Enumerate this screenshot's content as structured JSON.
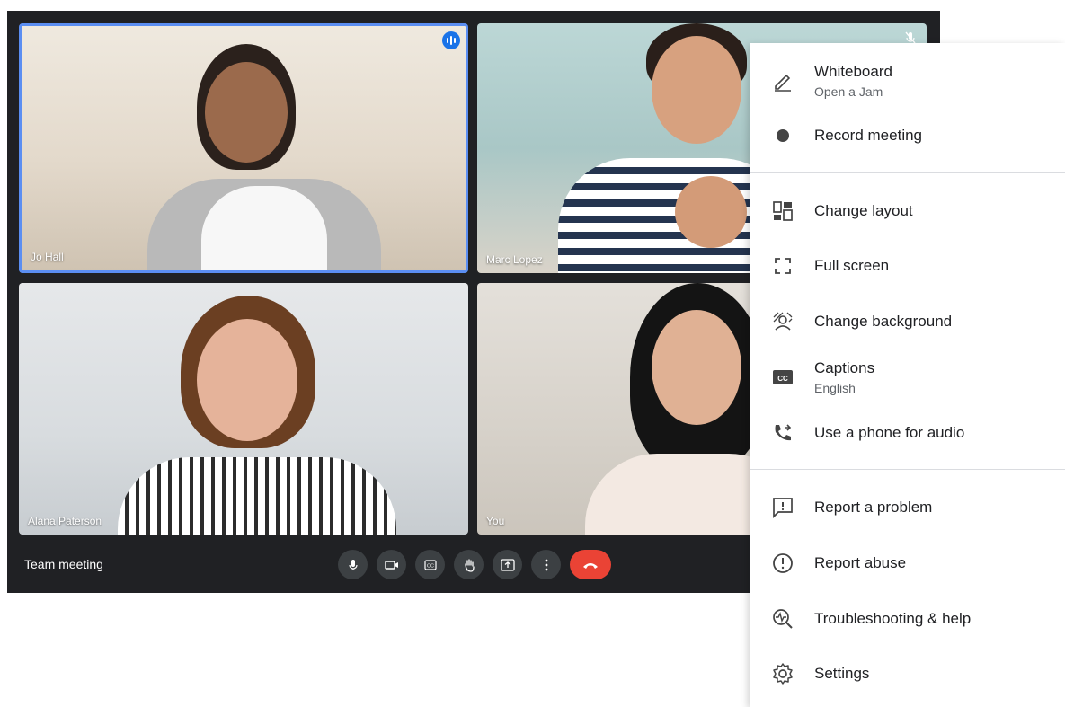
{
  "meeting": {
    "title": "Team meeting",
    "participants": [
      {
        "name": "Jo Hall",
        "speaking": true
      },
      {
        "name": "Marc Lopez",
        "muted": true
      },
      {
        "name": "Alana Paterson"
      },
      {
        "name": "You"
      }
    ],
    "controls": [
      {
        "name": "microphone",
        "icon": "mic-icon"
      },
      {
        "name": "camera",
        "icon": "camera-icon"
      },
      {
        "name": "captions",
        "icon": "captions-icon"
      },
      {
        "name": "raise-hand",
        "icon": "hand-icon"
      },
      {
        "name": "present",
        "icon": "present-icon"
      },
      {
        "name": "more-options",
        "icon": "more-vert-icon"
      },
      {
        "name": "leave-call",
        "icon": "end-call-icon"
      }
    ],
    "colors": {
      "background": "#202124",
      "control": "#3c4043",
      "end_call": "#ea4335",
      "speaking": "#1a73e8"
    }
  },
  "menu": {
    "items": [
      {
        "label": "Whiteboard",
        "sub": "Open a Jam",
        "icon": "pen-icon"
      },
      {
        "label": "Record meeting",
        "icon": "record-icon"
      },
      {
        "label": "Change layout",
        "icon": "layout-icon"
      },
      {
        "label": "Full screen",
        "icon": "fullscreen-icon"
      },
      {
        "label": "Change background",
        "icon": "background-icon"
      },
      {
        "label": "Captions",
        "sub": "English",
        "icon": "cc-icon"
      },
      {
        "label": "Use a phone for audio",
        "icon": "phone-icon"
      },
      {
        "label": "Report a problem",
        "icon": "feedback-icon"
      },
      {
        "label": "Report abuse",
        "icon": "alert-icon"
      },
      {
        "label": "Troubleshooting & help",
        "icon": "troubleshoot-icon"
      },
      {
        "label": "Settings",
        "icon": "settings-icon"
      }
    ]
  }
}
